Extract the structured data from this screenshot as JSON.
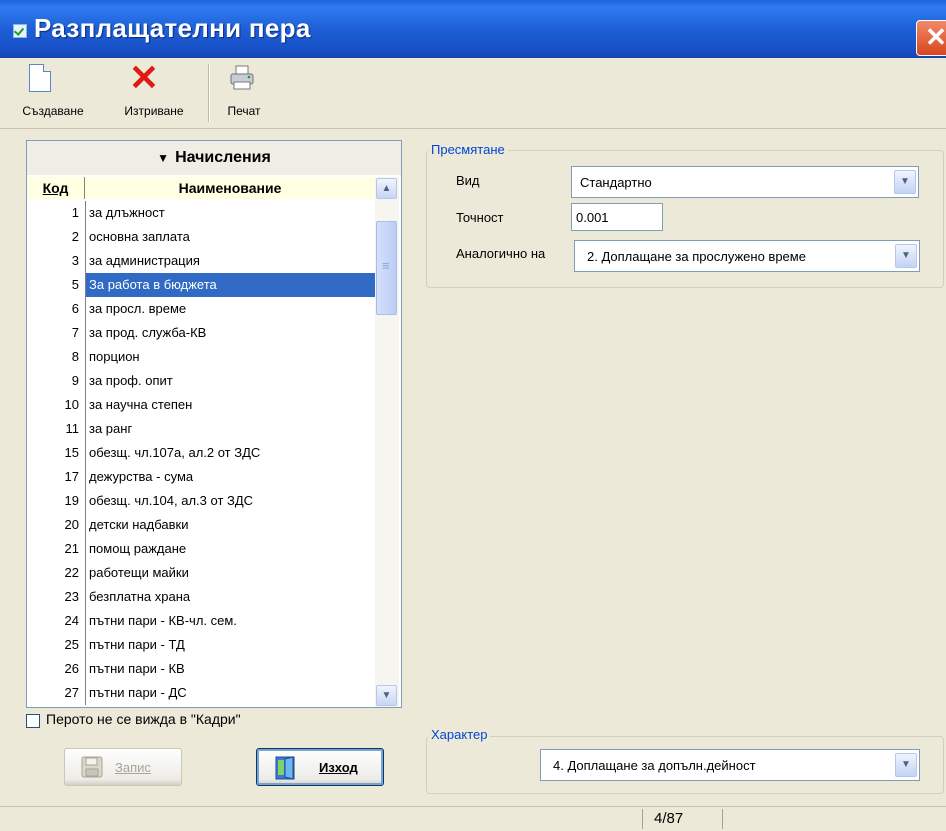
{
  "window": {
    "title": "Разплащателни пера",
    "close_glyph": "✕"
  },
  "toolbar": {
    "create_label": "Създаване",
    "delete_label": "Изтриване",
    "print_label": "Печат"
  },
  "list": {
    "header": "Начисления",
    "columns": {
      "code": "Код",
      "name": "Наименование"
    },
    "rows": [
      {
        "code": "1",
        "name": "за длъжност"
      },
      {
        "code": "2",
        "name": "основна заплата"
      },
      {
        "code": "3",
        "name": "за администрация"
      },
      {
        "code": "5",
        "name": "За работа в бюджета",
        "selected": true
      },
      {
        "code": "6",
        "name": "за просл. време"
      },
      {
        "code": "7",
        "name": "за прод. служба-КВ"
      },
      {
        "code": "8",
        "name": "порцион"
      },
      {
        "code": "9",
        "name": "за проф. опит"
      },
      {
        "code": "10",
        "name": "за научна степен"
      },
      {
        "code": "11",
        "name": "за ранг"
      },
      {
        "code": "15",
        "name": "обезщ. чл.107а, ал.2 от ЗДС"
      },
      {
        "code": "17",
        "name": "дежурства - сума"
      },
      {
        "code": "19",
        "name": "обезщ. чл.104, ал.3 от ЗДС"
      },
      {
        "code": "20",
        "name": "детски надбавки"
      },
      {
        "code": "21",
        "name": "помощ раждане"
      },
      {
        "code": "22",
        "name": "работещи майки"
      },
      {
        "code": "23",
        "name": "безплатна храна"
      },
      {
        "code": "24",
        "name": "пътни пари - КВ-чл. сем."
      },
      {
        "code": "25",
        "name": "пътни пари - ТД"
      },
      {
        "code": "26",
        "name": "пътни пари - КВ"
      },
      {
        "code": "27",
        "name": "пътни пари - ДС"
      }
    ]
  },
  "hidden_checkbox": {
    "label": "Перото не се вижда в \"Кадри\"",
    "checked": false
  },
  "buttons": {
    "save_label": "Запис",
    "exit_label": "Изход"
  },
  "calculation": {
    "title": "Пресмятане",
    "type_label": "Вид",
    "type_value": "Стандартно",
    "precision_label": "Точност",
    "precision_value": "0.001",
    "similar_label": "Аналогично на",
    "similar_value": "2. Доплащане за прослужено време"
  },
  "character": {
    "title": "Характер",
    "value": "4. Доплащане за допълн.дейност"
  },
  "status": {
    "record_position": "4/87"
  },
  "colors": {
    "titlebar": "#2F6FE4",
    "selection": "#316AC5",
    "group_title": "#0046D5",
    "delete_icon": "#E01A10"
  }
}
